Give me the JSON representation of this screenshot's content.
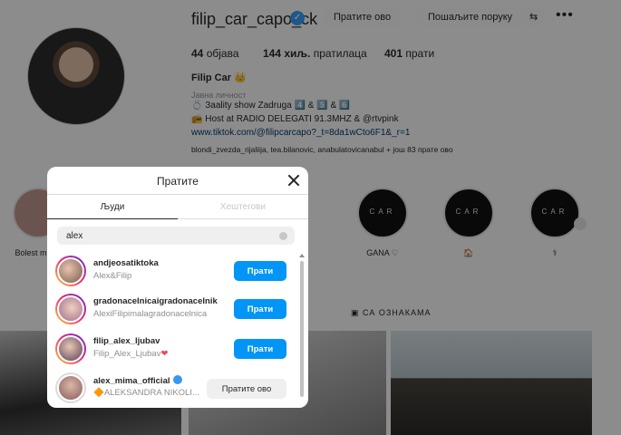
{
  "profile": {
    "username": "filip_car_capo_ck",
    "follow_button": "Пратите ово",
    "message_button": "Пошаљите поруку",
    "posts_count": "44",
    "posts_label": "објава",
    "followers_count": "144 хиљ.",
    "followers_label": "пратилаца",
    "following_count": "401",
    "following_label": "прати",
    "full_name": "Filip Car 👑",
    "category": "Јавна личност",
    "bio_lines": [
      "💍 Зaality show Zadruga 4️⃣ & 5️⃣ & 6️⃣",
      "📻 Host at RADIO DELEGATI 91.3MHZ & @rtvpink",
      "www.tiktok.com/@filipcarcapo?_t=8da1wCto6F1&_r=1"
    ],
    "followed_by": "blondi_zvezda_rijaliija, tea.bilanovic, anabulatovicanabul + још 83 прате ово",
    "highlights": [
      {
        "label": "Bolest m"
      },
      {
        "label": "GANA ♡"
      },
      {
        "label": "🏠"
      },
      {
        "label": "⚕"
      }
    ],
    "highlight_text": "CAR",
    "tagged_tab": "СА ОЗНАКАМА"
  },
  "modal": {
    "title": "Пратите",
    "tab_people": "Људи",
    "tab_hashtags": "Хештегови",
    "search_value": "alex",
    "rows": [
      {
        "username": "andjeosatiktoka",
        "subtitle": "Alex&Filip",
        "button": "Прати",
        "verified": false
      },
      {
        "username": "gradonacelnicaigradonacelnik",
        "subtitle": "AlexiFilipimalagradonacelnica",
        "button": "Прати",
        "verified": false
      },
      {
        "username": "filip_alex_ljubav",
        "subtitle": "Filip_Alex_Ljubav",
        "subtitle_suffix": "❤",
        "button": "Прати",
        "verified": false
      },
      {
        "username": "alex_mima_official",
        "subtitle": "🔶ALEKSANDRA NIKOLI...",
        "button": "Пратите ово",
        "verified": true
      }
    ]
  },
  "colors": {
    "accent": "#0095f6",
    "verified": "#3897f0",
    "overlay": "rgba(0,0,0,0.42)"
  }
}
